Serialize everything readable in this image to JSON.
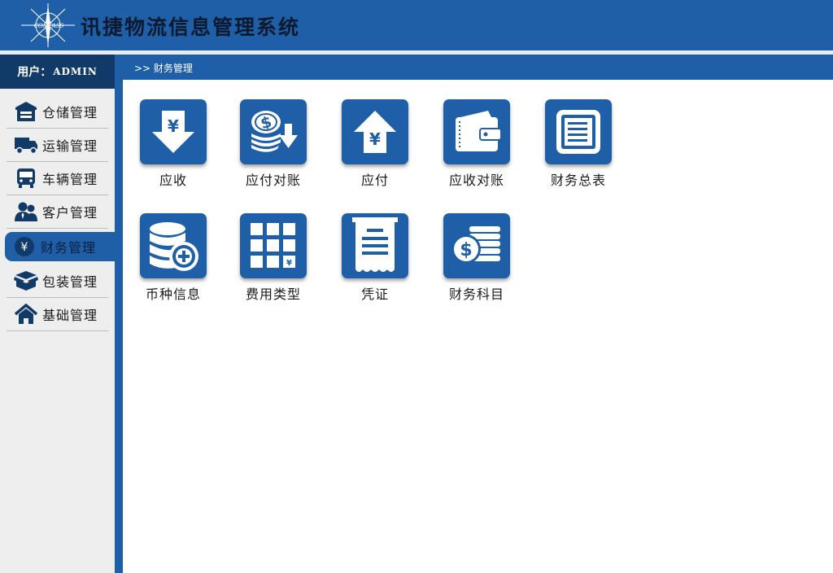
{
  "header": {
    "logo_text": "COMPASS",
    "title": "讯捷物流信息管理系统"
  },
  "user": {
    "label": "用户：",
    "name": "ADMIN"
  },
  "sidebar": {
    "items": [
      {
        "label": "仓储管理",
        "icon": "warehouse-icon"
      },
      {
        "label": "运输管理",
        "icon": "truck-icon"
      },
      {
        "label": "车辆管理",
        "icon": "bus-icon"
      },
      {
        "label": "客户管理",
        "icon": "customers-icon"
      },
      {
        "label": "财务管理",
        "icon": "yen-circle-icon",
        "active": true
      },
      {
        "label": "包装管理",
        "icon": "package-icon"
      },
      {
        "label": "基础管理",
        "icon": "home-icon"
      }
    ]
  },
  "breadcrumb": ">> 财务管理",
  "tiles": [
    {
      "label": "应收",
      "icon": "yen-down-arrow-icon"
    },
    {
      "label": "应付对账",
      "icon": "coins-down-arrow-icon"
    },
    {
      "label": "应付",
      "icon": "yen-up-arrow-icon"
    },
    {
      "label": "应收对账",
      "icon": "wallet-icon"
    },
    {
      "label": "财务总表",
      "icon": "ledger-icon"
    },
    {
      "label": "币种信息",
      "icon": "coin-stack-plus-icon"
    },
    {
      "label": "费用类型",
      "icon": "grid-yen-icon"
    },
    {
      "label": "凭证",
      "icon": "receipt-icon"
    },
    {
      "label": "财务科目",
      "icon": "dollar-coins-icon"
    }
  ],
  "colors": {
    "primary": "#1f5fa8",
    "user_bar": "#123a68",
    "sidebar_bg": "#eeeeee"
  }
}
